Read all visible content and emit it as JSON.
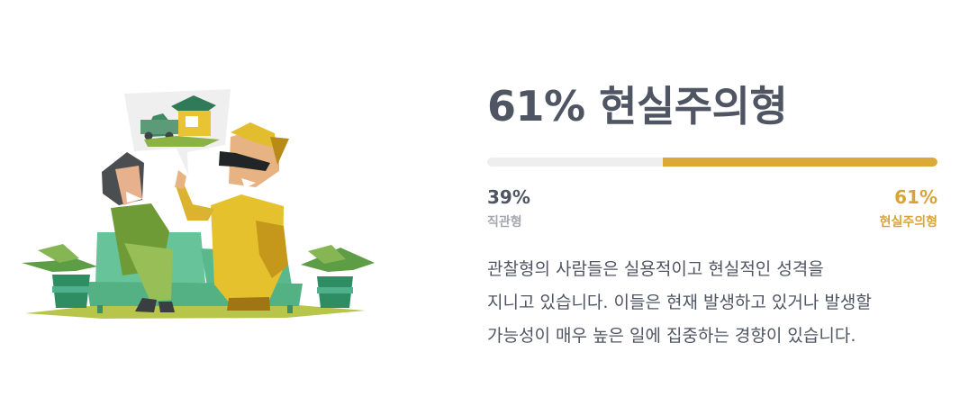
{
  "result": {
    "headline": "61% 현실주의형",
    "bar": {
      "left_share": 0.39,
      "right_share": 0.61,
      "fill_color": "#dca936",
      "track_color": "#eeeeee"
    },
    "left_stat": {
      "percent": "39%",
      "label": "직관형"
    },
    "right_stat": {
      "percent": "61%",
      "label": "현실주의형"
    },
    "description_lines": [
      "관찰형의 사람들은 실용적이고 현실적인 성격을",
      "지니고 있습니다. 이들은 현재 발생하고 있거나 발생할",
      "가능성이 매우 높은 일에 집중하는 경향이 있습니다."
    ]
  },
  "colors": {
    "heading": "#4f5563",
    "accent": "#d8a43a",
    "muted": "#a3a7ad"
  }
}
